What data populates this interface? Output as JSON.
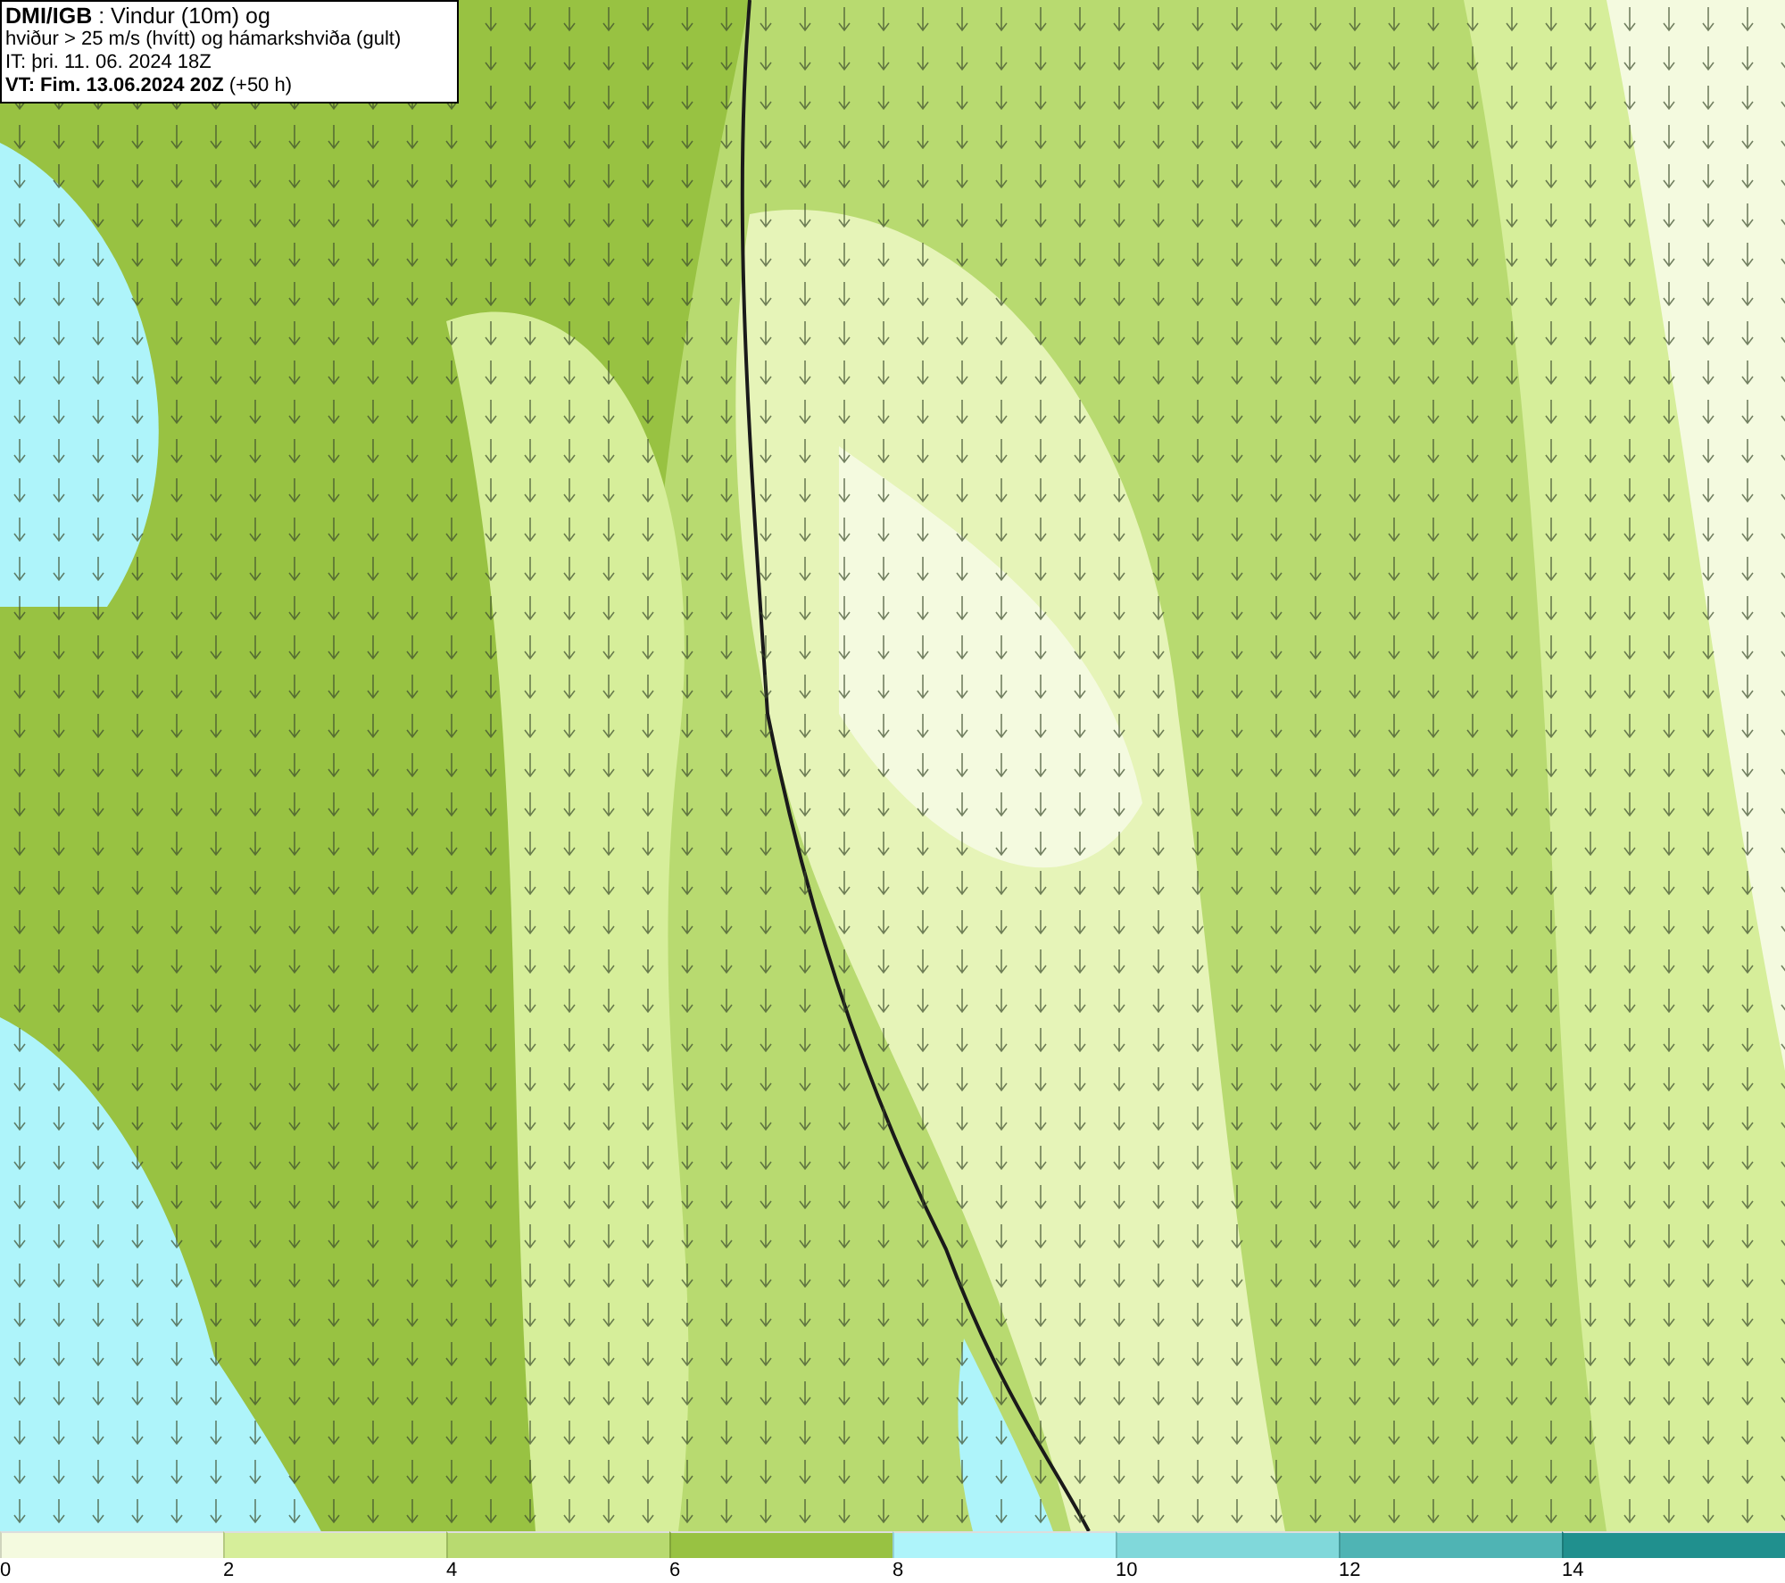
{
  "header": {
    "lines": [
      "**DMI/IGB** : Vindur (10m) og",
      "hviður > 25 m/s (hvítt) og hámarkshviða (gult)",
      "IT: þri. 11. 06. 2024 18Z",
      "**VT: Fim. 13.06.2024 20Z** (+50 h)"
    ]
  },
  "legend": {
    "bins": [
      {
        "label": "0",
        "color": "#f4fadf"
      },
      {
        "label": "2",
        "color": "#d6ee9a"
      },
      {
        "label": "4",
        "color": "#b8da70"
      },
      {
        "label": "6",
        "color": "#98c242"
      },
      {
        "label": "8",
        "color": "#aef4fa"
      },
      {
        "label": "10",
        "color": "#80d8da"
      },
      {
        "label": "12",
        "color": "#4fb4b4"
      },
      {
        "label": "14",
        "color": "#20908e"
      }
    ]
  }
}
